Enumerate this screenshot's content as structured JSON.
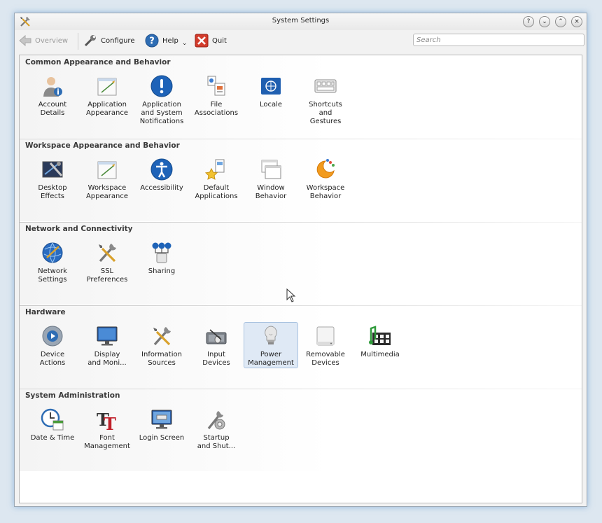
{
  "window": {
    "title": "System Settings"
  },
  "titlebar": {
    "app_icon": "tools-icon",
    "buttons": [
      {
        "name": "help-button",
        "glyph": "?"
      },
      {
        "name": "minimize-button",
        "glyph": "⌄"
      },
      {
        "name": "maximize-button",
        "glyph": "⌃"
      },
      {
        "name": "close-button",
        "glyph": "×"
      }
    ]
  },
  "toolbar": {
    "overview_label": "Overview",
    "configure_label": "Configure",
    "help_label": "Help",
    "quit_label": "Quit",
    "search_placeholder": "Search"
  },
  "sections": [
    {
      "title": "Common Appearance and Behavior",
      "items": [
        {
          "label": "Account\nDetails",
          "icon": "user-info-icon"
        },
        {
          "label": "Application\nAppearance",
          "icon": "appearance-icon"
        },
        {
          "label": "Application\nand System\nNotifications",
          "icon": "notification-icon"
        },
        {
          "label": "File\nAssociations",
          "icon": "file-associations-icon"
        },
        {
          "label": "Locale",
          "icon": "flag-icon"
        },
        {
          "label": "Shortcuts\nand\nGestures",
          "icon": "keyboard-icon"
        }
      ]
    },
    {
      "title": "Workspace Appearance and Behavior",
      "items": [
        {
          "label": "Desktop\nEffects",
          "icon": "desktop-effects-icon"
        },
        {
          "label": "Workspace\nAppearance",
          "icon": "appearance-icon"
        },
        {
          "label": "Accessibility",
          "icon": "accessibility-icon"
        },
        {
          "label": "Default\nApplications",
          "icon": "default-apps-icon"
        },
        {
          "label": "Window\nBehavior",
          "icon": "window-icon"
        },
        {
          "label": "Workspace\nBehavior",
          "icon": "workspace-behavior-icon"
        }
      ]
    },
    {
      "title": "Network and Connectivity",
      "items": [
        {
          "label": "Network\nSettings",
          "icon": "globe-icon"
        },
        {
          "label": "SSL\nPreferences",
          "icon": "tools-icon"
        },
        {
          "label": "Sharing",
          "icon": "sharing-icon"
        }
      ]
    },
    {
      "title": "Hardware",
      "items": [
        {
          "label": "Device\nActions",
          "icon": "device-actions-icon"
        },
        {
          "label": "Display\nand Moni...",
          "icon": "monitor-icon"
        },
        {
          "label": "Information\nSources",
          "icon": "tools-icon"
        },
        {
          "label": "Input\nDevices",
          "icon": "input-devices-icon"
        },
        {
          "label": "Power\nManagement",
          "icon": "lightbulb-icon",
          "selected": true
        },
        {
          "label": "Removable\nDevices",
          "icon": "drive-icon"
        },
        {
          "label": "Multimedia",
          "icon": "multimedia-icon"
        }
      ]
    },
    {
      "title": "System Administration",
      "items": [
        {
          "label": "Date & Time",
          "icon": "clock-icon"
        },
        {
          "label": "Font\nManagement",
          "icon": "font-icon"
        },
        {
          "label": "Login Screen",
          "icon": "login-screen-icon"
        },
        {
          "label": "Startup\nand Shut...",
          "icon": "startup-icon"
        }
      ]
    }
  ],
  "colors": {
    "accent": "#3b6fb6",
    "selected_bg": "#dfe9f5",
    "quit_red": "#d23b2b"
  }
}
